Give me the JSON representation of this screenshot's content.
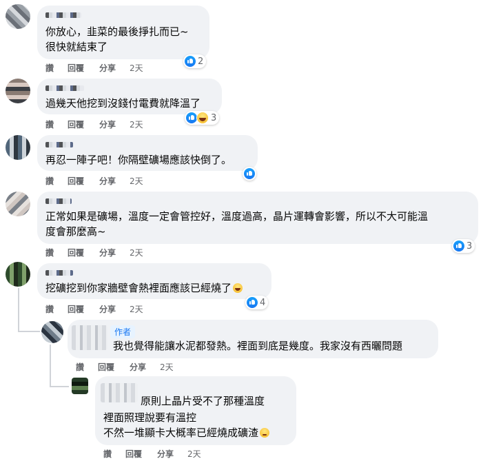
{
  "actions": {
    "like": "讚",
    "reply": "回覆",
    "share": "分享"
  },
  "comments": [
    {
      "lines": [
        "你放心，韭菜的最後掙扎而已~",
        "很快就結束了"
      ],
      "time": "2天",
      "reactions": {
        "icons": [
          "like-icon"
        ],
        "count": "2"
      }
    },
    {
      "lines": [
        "過幾天他挖到沒錢付電費就降溫了"
      ],
      "time": "2天",
      "reactions": {
        "icons": [
          "like-icon",
          "haha-icon"
        ],
        "count": "3"
      }
    },
    {
      "lines": [
        "再忍一陣子吧！你隔壁礦場應該快倒了。"
      ],
      "time": "2天",
      "reactions": {
        "icons": [
          "like-icon"
        ],
        "count": ""
      }
    },
    {
      "lines": [
        "正常如果是礦場，溫度一定會管控好，溫度過高，晶片運轉會影響，所以不大可能溫",
        "度會那麼高~"
      ],
      "time": "2天",
      "reactions": {
        "icons": [
          "like-icon"
        ],
        "count": "3"
      }
    },
    {
      "lines": [
        "挖礦挖到你家牆壁會熱裡面應該已經燒了"
      ],
      "trailing_emoji": "laughing-emoji",
      "time": "2天",
      "reactions": {
        "icons": [
          "like-icon"
        ],
        "count": "4"
      }
    }
  ],
  "replies": [
    {
      "author_badge": "作者",
      "lines": [
        "我也覺得能讓水泥都發熱。裡面到底是幾度。我家沒有西曬問題"
      ],
      "time": "2天"
    },
    {
      "lines": [
        "原則上晶片受不了那種溫度",
        "裡面照理說要有溫控",
        "不然一堆顯卡大概率已經燒成礦渣"
      ],
      "trailing_emoji": "thinking-emoji",
      "time": "2天"
    }
  ]
}
